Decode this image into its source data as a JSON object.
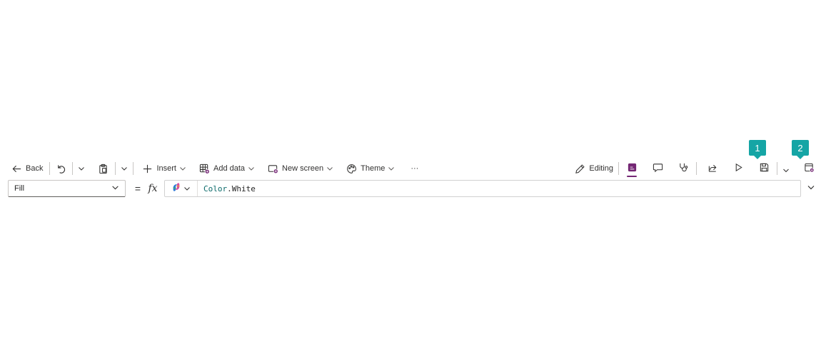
{
  "toolbar": {
    "back_label": "Back",
    "insert_label": "Insert",
    "add_data_label": "Add data",
    "new_screen_label": "New screen",
    "theme_label": "Theme",
    "more_label": "···",
    "editing_label": "Editing"
  },
  "markers": {
    "save": "1",
    "publish": "2"
  },
  "formula_bar": {
    "property": "Fill",
    "equals": "=",
    "fx": "fx",
    "formula_namespace": "Color",
    "formula_member": ".White"
  },
  "colors": {
    "accent": "#742774",
    "marker": "#15a5a5",
    "formula_keyword": "#0b6a6a"
  },
  "icons": [
    "back-arrow-icon",
    "undo-icon",
    "paste-icon",
    "plus-icon",
    "table-add-icon",
    "new-screen-icon",
    "palette-icon",
    "pencil-icon",
    "editor-icon",
    "comment-icon",
    "stethoscope-icon",
    "share-icon",
    "play-icon",
    "save-icon",
    "publish-icon",
    "copilot-icon",
    "chevron-down-icon"
  ]
}
